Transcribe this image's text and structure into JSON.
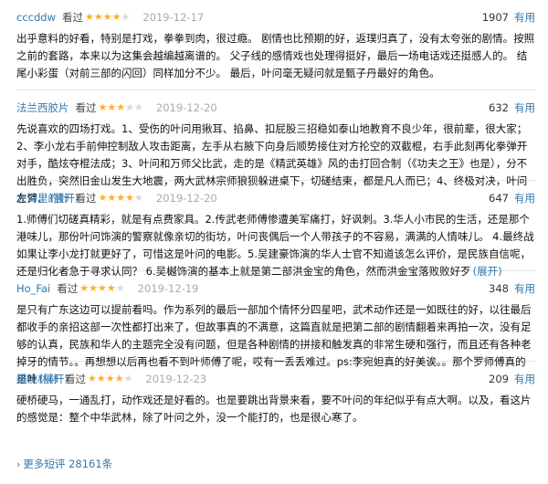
{
  "seen_label": "看过",
  "useful_label": "有用",
  "expand_label": "(展开)",
  "star_color": "#ffac2d",
  "link_color": "#3377aa",
  "reviews": [
    {
      "user": "cccddw",
      "rating": 4,
      "date": "2019-12-17",
      "votes": "1907",
      "text": "出乎意料的好看，特别是打戏，拳拳到肉，很过瘾。 剧情也比预期的好，返璞归真了，没有太夸张的剧情。按照之前的套路，本来以为这集会越编越离谱的。 父子线的感情戏也处理得挺好，最后一场电话戏还挺感人的。 结尾小彩蛋（对前三部的闪回）同样加分不少。 最后，叶问毫无疑问就是甄子丹最好的角色。",
      "expandable": false
    },
    {
      "user": "法兰西胶片",
      "rating": 3,
      "date": "2019-12-20",
      "votes": "632",
      "text": "先说喜欢的四场打戏。1、受伤的叶问用揪耳、掐鼻、扣屁股三招稳如泰山地教育不良少年，很前辈，很大家；2、李小龙右手前伸控制敌人攻击距离，左手从右腋下向身后顺势接住对方抡空的双截棍，右手此刻再化拳弹开对手，酷炫夺棍法成；3、叶问和万师父比武，走的是《精武英雄》风的击打回合制（《功夫之王》也是），分不出胜负，突然旧金山发生大地震，两大武林宗师狼狈躲进桌下，切磋结束，都是凡人而已；4、终极对决，叶问左臂、",
      "expandable": true
    },
    {
      "user": "大海里的针",
      "rating": 4,
      "date": "2019-12-20",
      "votes": "647",
      "text": "1.师傅们切磋真精彩，就是有点费家具。2.传武老师傅惨遭美军痛打，好讽刺。3.华人小市民的生活，还是那个港味儿，那份叶问饰演的警察就像亲切的街坊，叶问丧偶后一个人带孩子的不容易，满满的人情味儿。 4.最终战如果让李小龙打就更好了，可惜这是叶问的电影。5.吴建豪饰演的华人士官不知道该怎么评价，是民族自信呢，还是归化者急于寻求认同？ 6.吴樾饰演的基本上就是第二部洪金宝的角色，然而洪金宝落败败好歹",
      "expandable": true
    },
    {
      "user": "Ho_Fai",
      "rating": 4,
      "date": "2019-12-19",
      "votes": "348",
      "text": "是只有广东这边可以提前看吗。作为系列的最后一部加个情怀分四星吧，武术动作还是一如既往的好，以往最后都收手的亲招这部一次性都打出来了，但故事真的不满意，这篇直就是把第二部的剧情翻着来再拍一次，没有足够的认真，民族和华人的主题完全没有问题，但是各种剧情的拼接和触发真的非常生硬和强行，而且还有各种老掉牙的情节。。再想想以后再也看不到叶师傅了呢，哎有一丢丢难过。ps:李宛妲真的好美诶。。那个罗师傅真的是叶",
      "expandable": true
    },
    {
      "user": "桃桃林林",
      "rating": 4,
      "date": "2019-12-23",
      "votes": "209",
      "text": "硬桥硬马，一通乱打，动作戏还是好看的。也是要跳出背景来看，要不叶问的年纪似乎有点大啊。以及，看这片的感觉是：整个中华武林，除了叶问之外，没一个能打的，也是很心寒了。",
      "expandable": false
    }
  ],
  "more_link": "更多短评 28161条"
}
